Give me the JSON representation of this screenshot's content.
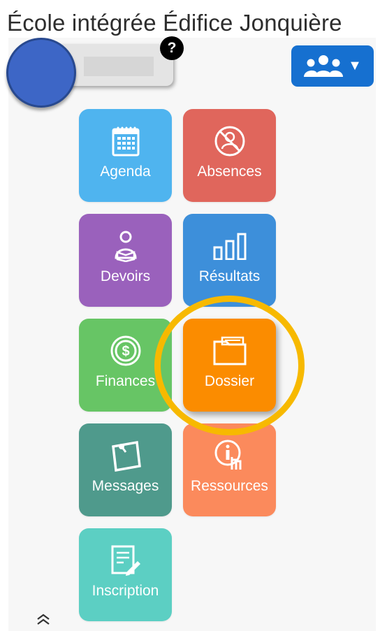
{
  "header": {
    "school_name": "École intégrée Édifice Jonquière"
  },
  "profile": {
    "help_icon_glyph": "?"
  },
  "children_selector": {
    "icon": "users-icon",
    "caret": "▼"
  },
  "tiles": [
    {
      "label": "Agenda",
      "icon": "calendar-icon",
      "color": "#4fb4ef"
    },
    {
      "label": "Absences",
      "icon": "absence-icon",
      "color": "#e0665c"
    },
    {
      "label": "Devoirs",
      "icon": "reader-icon",
      "color": "#9a61bc"
    },
    {
      "label": "Résultats",
      "icon": "bar-chart-icon",
      "color": "#3d8fda"
    },
    {
      "label": "Finances",
      "icon": "dollar-icon",
      "color": "#67c565"
    },
    {
      "label": "Dossier",
      "icon": "folder-icon",
      "color": "#fb8c00"
    },
    {
      "label": "Messages",
      "icon": "note-icon",
      "color": "#4f9a8c"
    },
    {
      "label": "Ressources",
      "icon": "info-touch-icon",
      "color": "#fb8a5c"
    },
    {
      "label": "Inscription",
      "icon": "form-edit-icon",
      "color": "#5ccfc3"
    }
  ],
  "colors": {
    "highlight_ring": "#f7b900",
    "button_blue": "#1670d0",
    "avatar_blue": "#3d66c6"
  },
  "footer": {
    "collapse_icon": "double-chevron-up-icon"
  }
}
